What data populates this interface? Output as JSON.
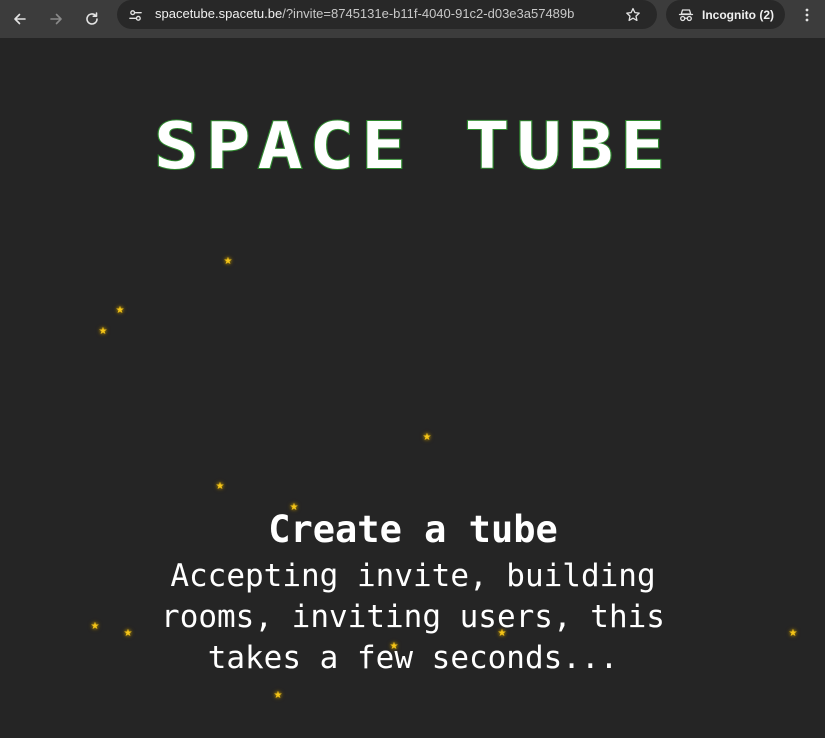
{
  "browser": {
    "url_host": "spacetube.spacetu.be",
    "url_path": "/?invite=8745131e-b11f-4040-91c2-d03e3a57489b",
    "incognito_label": "Incognito (2)"
  },
  "page": {
    "logo_text": "SPACE TUBE",
    "title": "Create a tube",
    "message": "Accepting invite, building rooms, inviting users, this takes a few seconds...",
    "star_glyph": "★"
  },
  "icons": {
    "back": "arrow-left-icon",
    "forward": "arrow-right-icon",
    "reload": "reload-icon",
    "site_info": "tune-icon",
    "bookmark": "star-outline-icon",
    "incognito": "incognito-icon",
    "menu": "kebab-menu-icon",
    "decor": "star-icon"
  },
  "colors": {
    "background": "#252525",
    "toolbar": "#3c3c3c",
    "omnibox": "#282828",
    "logo_fill": "#ffffff",
    "logo_outline": "#2f8a2f",
    "star": "#f5c518",
    "text": "#ffffff"
  }
}
